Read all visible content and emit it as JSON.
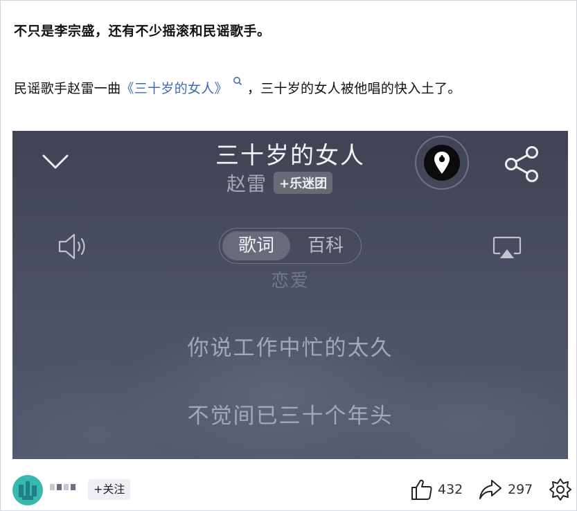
{
  "post": {
    "line1": "不只是李宗盛，还有不少摇滚和民谣歌手。",
    "line2_prefix": "民谣歌手赵雷一曲",
    "line2_link": "《三十岁的女人》",
    "line2_suffix": "，三十岁的女人被他唱的快入土了。"
  },
  "player": {
    "song_title": "三十岁的女人",
    "artist": "赵雷",
    "fan_button": "+乐迷团",
    "tabs": [
      "歌词",
      "百科"
    ],
    "active_tab": "歌词",
    "faded_lyric": "恋爱",
    "lyrics": [
      "你说工作中忙的太久",
      "不觉间已三十个年头"
    ]
  },
  "footer": {
    "follow_label": "+关注",
    "like_count": "432",
    "share_count": "297"
  },
  "colors": {
    "link": "#3b6bb0",
    "avatar": "#37b9b0",
    "player_bg": "#4a4f61"
  }
}
